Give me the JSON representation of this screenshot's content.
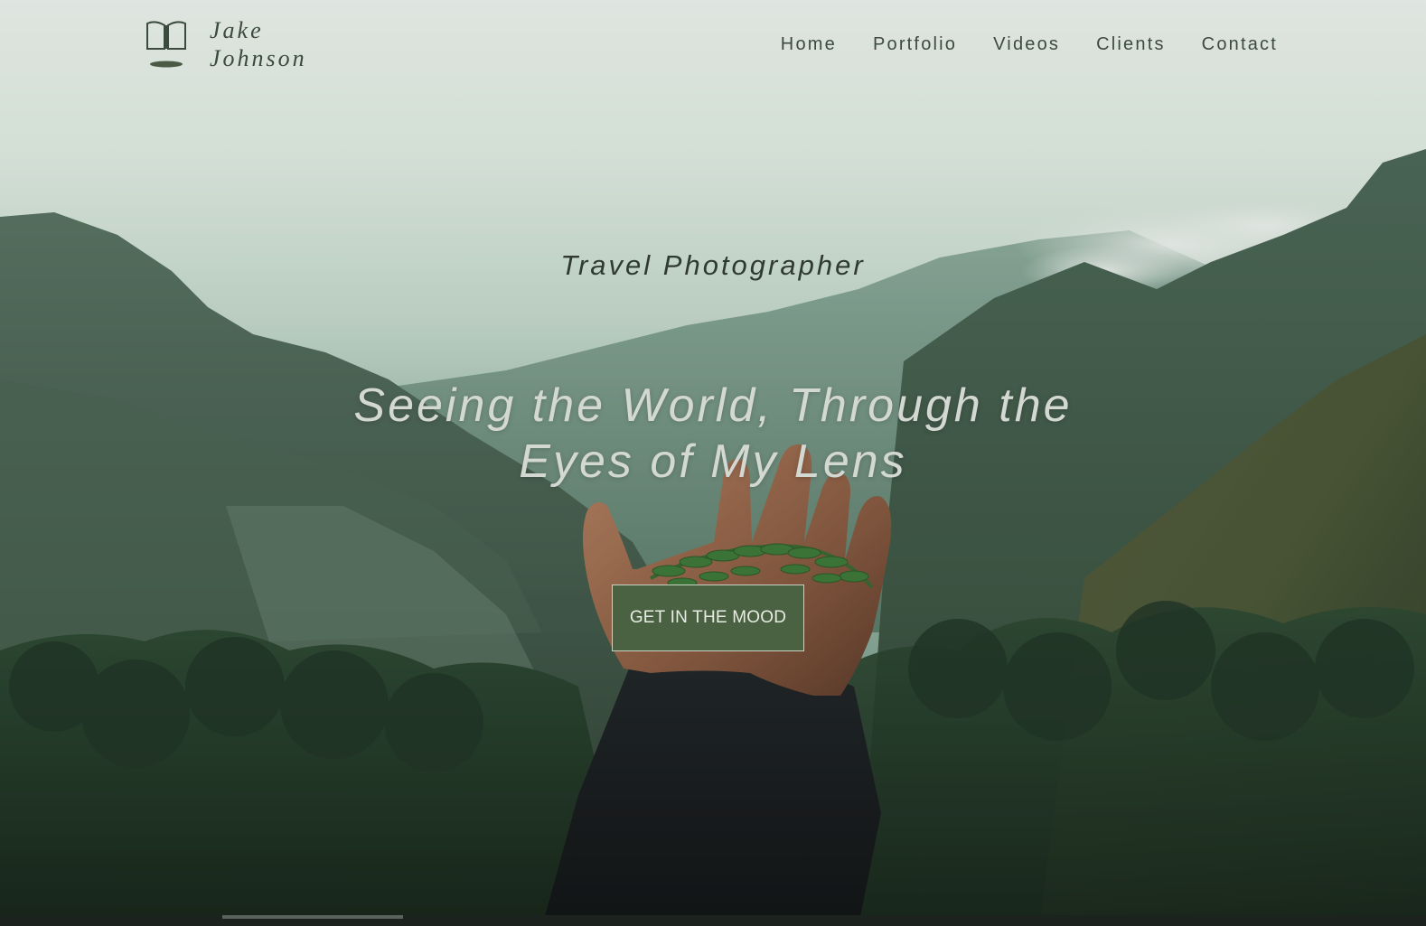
{
  "brand": {
    "first_name": "Jake",
    "last_name": "Johnson",
    "logo_icon": "open-book-icon"
  },
  "nav": {
    "items": [
      {
        "label": "Home"
      },
      {
        "label": "Portfolio"
      },
      {
        "label": "Videos"
      },
      {
        "label": "Clients"
      },
      {
        "label": "Contact"
      }
    ]
  },
  "hero": {
    "subtitle": "Travel Photographer",
    "headline_line1": "Seeing the World, Through the",
    "headline_line2": "Eyes of My Lens",
    "cta_label": "GET IN THE MOOD",
    "background": "misty-mountain-valley-with-outstretched-hand-holding-fern"
  },
  "colors": {
    "accent": "#4b6242",
    "nav_text": "#3d4a40",
    "headline_text": "#d4d8d3"
  }
}
